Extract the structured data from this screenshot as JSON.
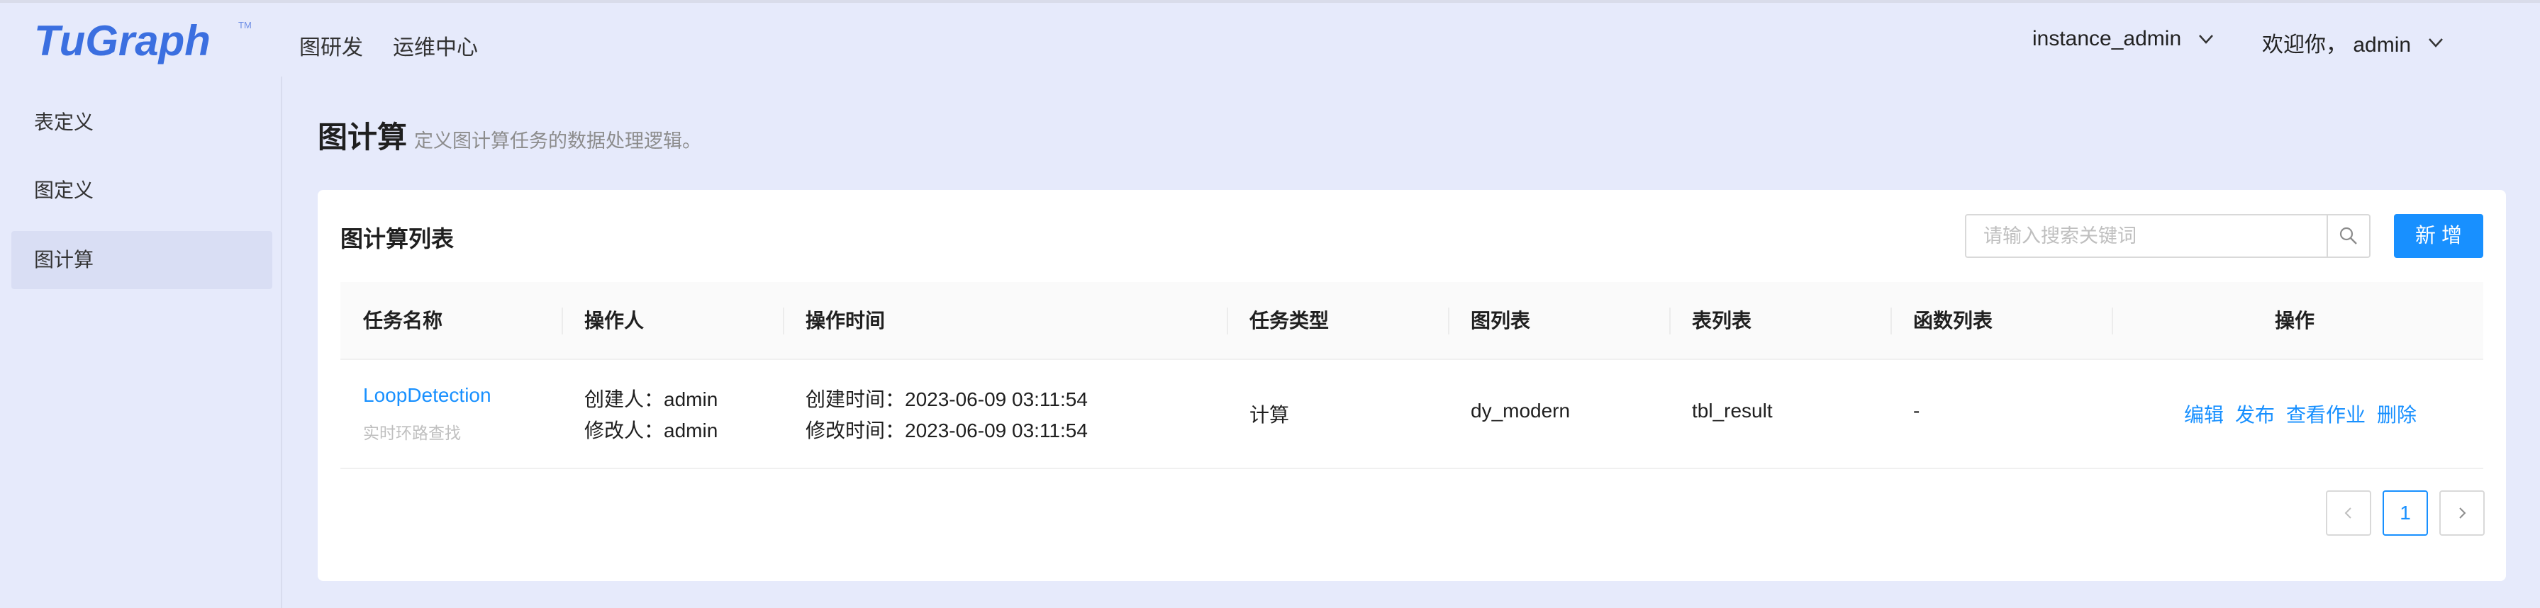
{
  "app": {
    "logo_text": "TuGraph",
    "logo_tm": "TM"
  },
  "nav": {
    "items": [
      {
        "label": "图研发"
      },
      {
        "label": "运维中心"
      }
    ]
  },
  "header_right": {
    "instance": "instance_admin",
    "welcome": "欢迎你， admin"
  },
  "sidebar": {
    "items": [
      {
        "label": "表定义"
      },
      {
        "label": "图定义"
      },
      {
        "label": "图计算",
        "active": true
      }
    ]
  },
  "page": {
    "title": "图计算",
    "description": "定义图计算任务的数据处理逻辑。"
  },
  "card": {
    "title": "图计算列表",
    "search_placeholder": "请输入搜索关键词",
    "add_label": "新 增"
  },
  "table": {
    "columns": [
      "任务名称",
      "操作人",
      "操作时间",
      "任务类型",
      "图列表",
      "表列表",
      "函数列表",
      "操作"
    ],
    "rows": [
      {
        "task_name": "LoopDetection",
        "task_desc": "实时环路查找",
        "creator": "创建人：admin",
        "modifier": "修改人：admin",
        "created_time": "创建时间：2023-06-09 03:11:54",
        "modified_time": "修改时间：2023-06-09 03:11:54",
        "task_type": "计算",
        "graphs": "dy_modern",
        "tables": "tbl_result",
        "functions": "-",
        "actions": [
          "编辑",
          "发布",
          "查看作业",
          "删除"
        ]
      }
    ]
  },
  "pagination": {
    "prev": "<",
    "current": "1",
    "next": ">"
  },
  "colors": {
    "primary": "#1890ff",
    "background": "#e6eafb",
    "logo": "#3b6fe0"
  },
  "icons": {
    "search": "search-icon",
    "chevron": "chevron-down-icon"
  }
}
